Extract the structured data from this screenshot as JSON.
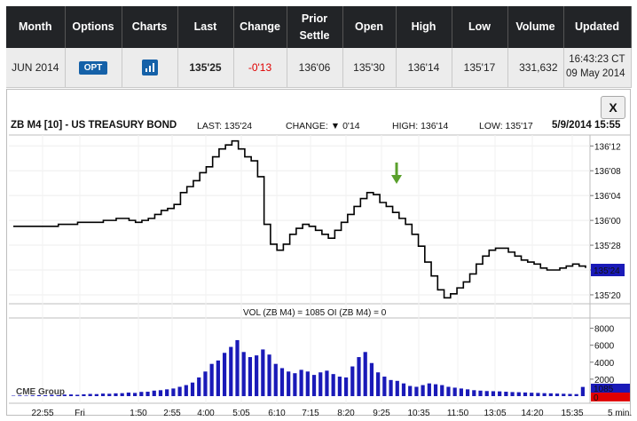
{
  "table": {
    "headers": [
      "Month",
      "Options",
      "Charts",
      "Last",
      "Change",
      "Prior Settle",
      "Open",
      "High",
      "Low",
      "Volume",
      "Updated"
    ],
    "row": {
      "month": "JUN 2014",
      "options_label": "OPT",
      "last": "135'25",
      "change": "-0'13",
      "prior_settle": "136'06",
      "open": "135'30",
      "high": "136'14",
      "low": "135'17",
      "volume": "331,632",
      "updated_time": "16:43:23 CT",
      "updated_date": "09 May 2014"
    }
  },
  "chart": {
    "close_label": "X",
    "symbol": "ZB M4 [10] - US TREASURY BOND",
    "last_label": "LAST: 135'24",
    "change_label": "CHANGE:",
    "change_value": "0'14",
    "high_label": "HIGH: 136'14",
    "low_label": "LOW: 135'17",
    "date": "5/9/2014 15:55",
    "volume_title": "VOL (ZB M4) = 1085  OI (ZB M4) = 0",
    "watermark": "CME Group",
    "colors": {
      "price_line": "#000000",
      "volume_bar": "#1a1ab8",
      "current_tag": "#1a1ab8",
      "arrow": "#5aa02c",
      "oi_tag": "#e00000"
    }
  },
  "chart_data": {
    "type": "line",
    "interval": "5 min.",
    "price_axis": {
      "ticks": [
        "136'12",
        "136'08",
        "136'04",
        "136'00",
        "135'28",
        "135'24",
        "135'20"
      ],
      "tick_values": [
        136.375,
        136.25,
        136.125,
        136.0,
        135.875,
        135.75,
        135.625
      ],
      "current": "135'24",
      "current_value": 135.75
    },
    "x_ticks": [
      "22:55",
      "Fri",
      "1:50",
      "2:55",
      "4:00",
      "5:05",
      "6:10",
      "7:15",
      "8:20",
      "9:25",
      "10:35",
      "11:50",
      "13:05",
      "14:20",
      "15:35",
      "5 min."
    ],
    "price_series": [
      135.97,
      135.97,
      135.97,
      135.97,
      135.97,
      135.97,
      135.97,
      135.98,
      135.98,
      135.98,
      135.99,
      135.99,
      135.99,
      135.99,
      136.0,
      136.0,
      136.01,
      136.01,
      136.0,
      135.99,
      136.0,
      136.01,
      136.03,
      136.05,
      136.06,
      136.08,
      136.14,
      136.17,
      136.2,
      136.24,
      136.27,
      136.32,
      136.36,
      136.38,
      136.4,
      136.36,
      136.32,
      136.3,
      136.22,
      135.98,
      135.88,
      135.85,
      135.88,
      135.93,
      135.96,
      135.98,
      135.97,
      135.95,
      135.93,
      135.91,
      135.95,
      135.99,
      136.03,
      136.07,
      136.11,
      136.14,
      136.13,
      136.09,
      136.07,
      136.04,
      136.01,
      135.98,
      135.93,
      135.87,
      135.79,
      135.72,
      135.65,
      135.61,
      135.63,
      135.66,
      135.69,
      135.73,
      135.78,
      135.82,
      135.85,
      135.86,
      135.86,
      135.84,
      135.82,
      135.8,
      135.79,
      135.78,
      135.76,
      135.75,
      135.75,
      135.76,
      135.77,
      135.78,
      135.77,
      135.76
    ],
    "volume_axis": {
      "ticks": [
        "8000",
        "6000",
        "4000",
        "2000"
      ],
      "tick_values": [
        8000,
        6000,
        4000,
        2000
      ],
      "current_volume": "1085",
      "current_oi": "0"
    },
    "volume_series": [
      50,
      80,
      60,
      90,
      120,
      100,
      150,
      110,
      180,
      200,
      160,
      220,
      260,
      240,
      300,
      280,
      330,
      350,
      420,
      380,
      500,
      520,
      650,
      700,
      800,
      900,
      1100,
      1300,
      1600,
      2200,
      2900,
      3800,
      4200,
      5100,
      5800,
      6600,
      5200,
      4600,
      4800,
      5500,
      4900,
      3800,
      3300,
      2900,
      2700,
      3100,
      2900,
      2500,
      2800,
      3000,
      2600,
      2300,
      2200,
      3500,
      4600,
      5200,
      3900,
      2800,
      2300,
      1900,
      1800,
      1500,
      1200,
      1100,
      1300,
      1500,
      1400,
      1300,
      1100,
      1000,
      900,
      800,
      700,
      650,
      600,
      580,
      560,
      520,
      480,
      460,
      430,
      400,
      380,
      350,
      330,
      300,
      280,
      260,
      240,
      1085
    ]
  }
}
